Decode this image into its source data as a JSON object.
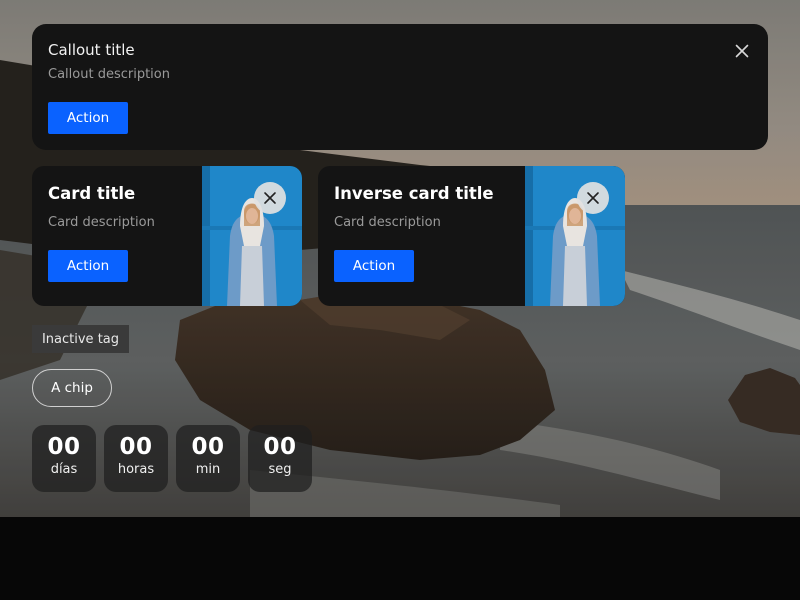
{
  "callout": {
    "title": "Callout title",
    "description": "Callout description",
    "action_label": "Action",
    "close_icon": "close-icon"
  },
  "cards": [
    {
      "title": "Card title",
      "description": "Card description",
      "action_label": "Action",
      "close_icon": "close-icon"
    },
    {
      "title": "Inverse card title",
      "description": "Card description",
      "action_label": "Action",
      "close_icon": "close-icon"
    }
  ],
  "tag": {
    "label": "Inactive tag"
  },
  "chip": {
    "label": "A chip"
  },
  "countdown": [
    {
      "value": "00",
      "unit": "días"
    },
    {
      "value": "00",
      "unit": "horas"
    },
    {
      "value": "00",
      "unit": "min"
    },
    {
      "value": "00",
      "unit": "seg"
    }
  ],
  "colors": {
    "accent": "#0a62ff",
    "surface": "#141414",
    "tag_background": "#3a3a3a",
    "page_bottom": "#070707"
  }
}
